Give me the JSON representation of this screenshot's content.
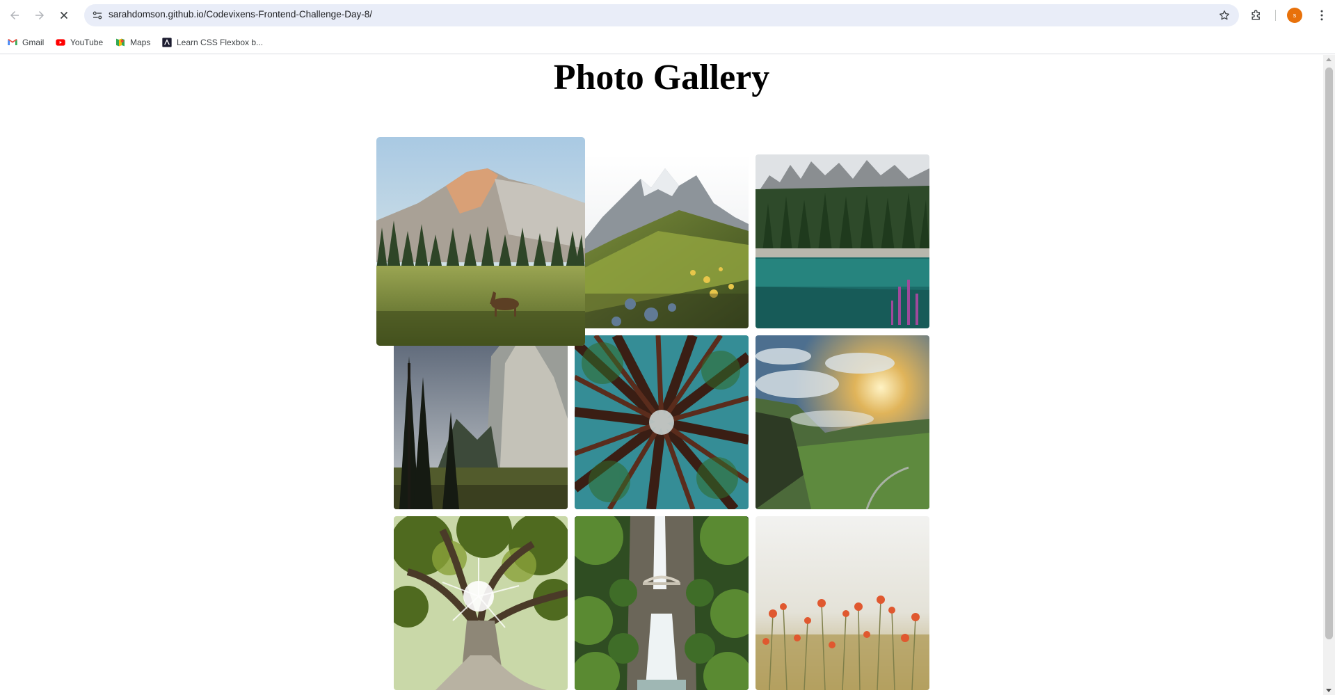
{
  "browser": {
    "url": "sarahdomson.github.io/Codevixens-Frontend-Challenge-Day-8/",
    "profile_initial": "s",
    "accent_color": "#e8710a",
    "bookmarks": [
      {
        "label": "Gmail",
        "icon": "gmail-icon"
      },
      {
        "label": "YouTube",
        "icon": "youtube-icon"
      },
      {
        "label": "Maps",
        "icon": "maps-icon"
      },
      {
        "label": "Learn CSS Flexbox b...",
        "icon": "flexbox-icon"
      }
    ]
  },
  "page": {
    "title": "Photo Gallery",
    "photos": [
      {
        "subject": "mountain-meadow-deer",
        "zoomed": true
      },
      {
        "subject": "alpine-peaks-wildflowers",
        "zoomed": false
      },
      {
        "subject": "mountain-lake-forest",
        "zoomed": false
      },
      {
        "subject": "granite-cliff-pines",
        "zoomed": false
      },
      {
        "subject": "redwood-canopy",
        "zoomed": false
      },
      {
        "subject": "misty-valley-sunset",
        "zoomed": false
      },
      {
        "subject": "giant-tree-sunburst",
        "zoomed": false
      },
      {
        "subject": "waterfall-bridge",
        "zoomed": false
      },
      {
        "subject": "poppy-field",
        "zoomed": false
      }
    ]
  }
}
